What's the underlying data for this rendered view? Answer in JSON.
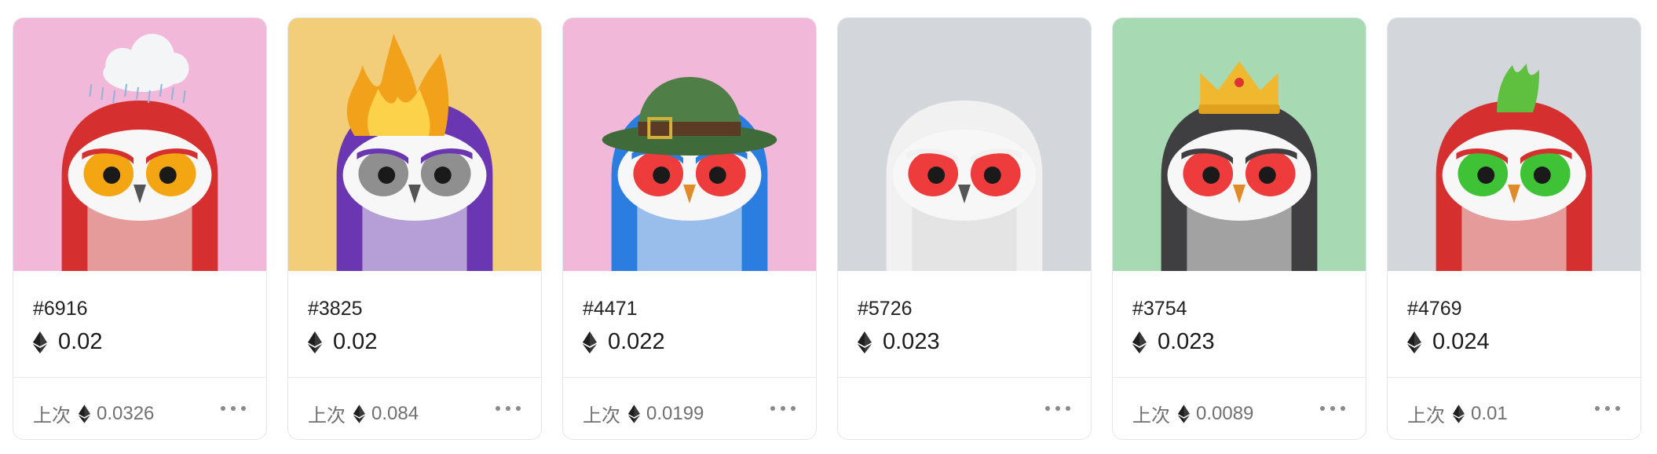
{
  "cards": [
    {
      "id": "#6916",
      "price": "0.02",
      "last_label": "上次",
      "last_price": "0.0326",
      "bg": "#f2b8d9",
      "owl": "#d5302f",
      "eyes": "#f3a512",
      "accessory": "cloud"
    },
    {
      "id": "#3825",
      "price": "0.02",
      "last_label": "上次",
      "last_price": "0.084",
      "bg": "#f2cd7a",
      "owl": "#6a36b2",
      "eyes": "#8f8f8f",
      "accessory": "fire"
    },
    {
      "id": "#4471",
      "price": "0.022",
      "last_label": "上次",
      "last_price": "0.0199",
      "bg": "#f2b8d9",
      "owl": "#2b7de0",
      "eyes": "#ee3b3b",
      "accessory": "hat"
    },
    {
      "id": "#5726",
      "price": "0.023",
      "last_label": "",
      "last_price": "",
      "bg": "#d3d6da",
      "owl": "#f1f1f1",
      "eyes": "#ee3b3b",
      "accessory": "none"
    },
    {
      "id": "#3754",
      "price": "0.023",
      "last_label": "上次",
      "last_price": "0.0089",
      "bg": "#a7d9b2",
      "owl": "#3f3f42",
      "eyes": "#ee3b3b",
      "accessory": "crown"
    },
    {
      "id": "#4769",
      "price": "0.024",
      "last_label": "上次",
      "last_price": "0.01",
      "bg": "#d3d6da",
      "owl": "#d5302f",
      "eyes": "#3fc236",
      "accessory": "mohawk"
    }
  ],
  "icons": {
    "currency": "ethereum-icon",
    "menu": "more-dots-icon"
  },
  "colors": {
    "card_border": "#e3e5e8",
    "muted_text": "#707070"
  }
}
